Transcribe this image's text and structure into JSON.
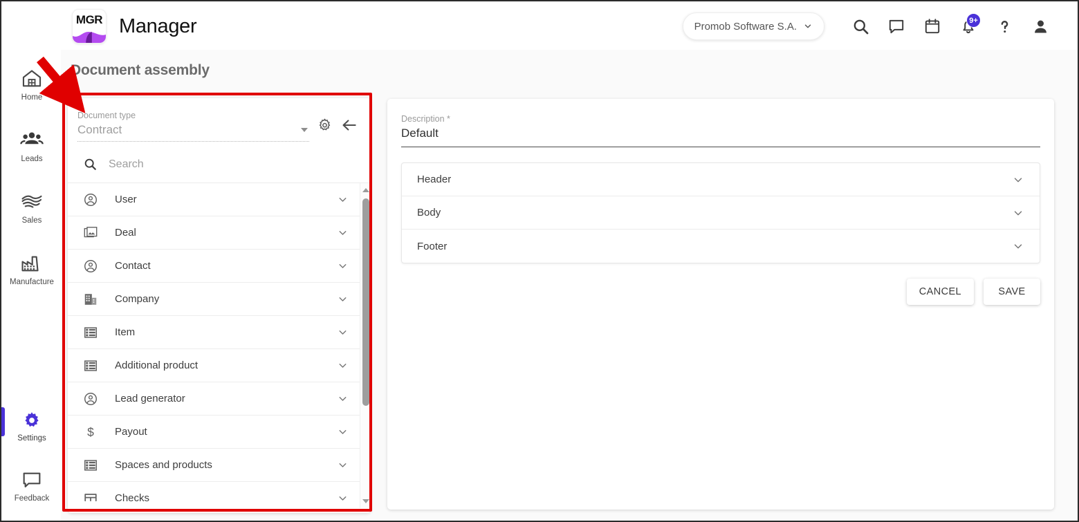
{
  "header": {
    "logo_text": "MGR",
    "brand_name": "Manager",
    "company_selector": "Promob Software S.A.",
    "icons": [
      {
        "name": "search-icon",
        "label": "Search"
      },
      {
        "name": "chat-icon",
        "label": "Messages"
      },
      {
        "name": "calendar-icon",
        "label": "Calendar"
      },
      {
        "name": "bell-icon",
        "label": "Notifications"
      },
      {
        "name": "help-icon",
        "label": "Help"
      },
      {
        "name": "account-icon",
        "label": "Account"
      }
    ],
    "notification_badge": "9+"
  },
  "sidebar": {
    "items": [
      {
        "label": "Home",
        "icon": "home-icon",
        "active": false
      },
      {
        "label": "Leads",
        "icon": "people-icon",
        "active": false
      },
      {
        "label": "Sales",
        "icon": "handshake-icon",
        "active": false
      },
      {
        "label": "Manufacture",
        "icon": "factory-icon",
        "active": false
      }
    ],
    "bottom_items": [
      {
        "label": "Settings",
        "icon": "gear-icon",
        "active": true
      },
      {
        "label": "Feedback",
        "icon": "chat-bubble-icon",
        "active": false
      }
    ]
  },
  "page": {
    "title": "Document assembly"
  },
  "left_panel": {
    "document_type": {
      "label": "Document type",
      "value": "Contract"
    },
    "settings_icon": "gear-icon",
    "back_icon": "arrow-left-icon",
    "search": {
      "placeholder": "Search",
      "value": ""
    },
    "list": [
      {
        "label": "User",
        "icon": "account-circle-icon"
      },
      {
        "label": "Deal",
        "icon": "image-stack-icon"
      },
      {
        "label": "Contact",
        "icon": "account-circle-icon"
      },
      {
        "label": "Company",
        "icon": "building-icon"
      },
      {
        "label": "Item",
        "icon": "list-icon"
      },
      {
        "label": "Additional product",
        "icon": "list-icon"
      },
      {
        "label": "Lead generator",
        "icon": "account-circle-icon"
      },
      {
        "label": "Payout",
        "icon": "dollar-icon"
      },
      {
        "label": "Spaces and products",
        "icon": "list-icon"
      },
      {
        "label": "Checks",
        "icon": "table-icon"
      }
    ]
  },
  "right_panel": {
    "description": {
      "label": "Description *",
      "value": "Default"
    },
    "sections": [
      {
        "label": "Header"
      },
      {
        "label": "Body"
      },
      {
        "label": "Footer"
      }
    ],
    "buttons": {
      "cancel": "CANCEL",
      "save": "SAVE"
    }
  },
  "colors": {
    "accent": "#4a32d8",
    "annotation": "#e00000",
    "logo_purple": "#b44bf0",
    "page_bg": "#fafafa"
  },
  "annotations": {
    "highlight_box": "left-panel-card",
    "arrow": "points-to-left-panel-card"
  }
}
